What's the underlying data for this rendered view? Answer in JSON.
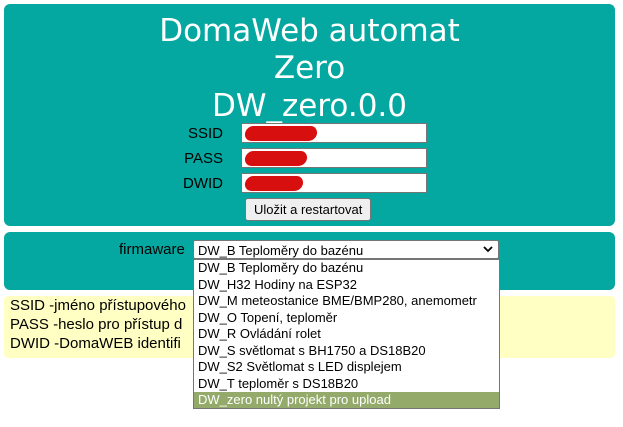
{
  "header": {
    "title_line1": "DomaWeb automat",
    "title_line2": "Zero",
    "title_line3": "DW_zero.0.0"
  },
  "form": {
    "ssid_label": "SSID",
    "pass_label": "PASS",
    "dwid_label": "DWID",
    "save_label": "Uložit a restartovat"
  },
  "firmware": {
    "label": "firmaware",
    "selected": "DW_B Teploměry do bazénu",
    "options": [
      "DW_B Teploměry do bazénu",
      "DW_H32 Hodiny na ESP32",
      "DW_M meteostanice BME/BMP280, anemometr",
      "DW_O Topení, teploměr",
      "DW_R Ovládání rolet",
      "DW_S světlomat s BH1750 a DS18B20",
      "DW_S2 Světlomat s LED displejem",
      "DW_T teploměr s DS18B20",
      "DW_zero nultý projekt pro upload"
    ],
    "highlighted_index": 8
  },
  "help": {
    "line1": "SSID -jméno přístupového",
    "line2": "PASS -heslo pro přístup d",
    "line3": "DWID -DomaWEB identifi"
  },
  "colors": {
    "panel": "#05a8a0",
    "help_bg": "#ffffc4",
    "highlight": "#93aa6a",
    "redaction": "#d80f0f"
  }
}
